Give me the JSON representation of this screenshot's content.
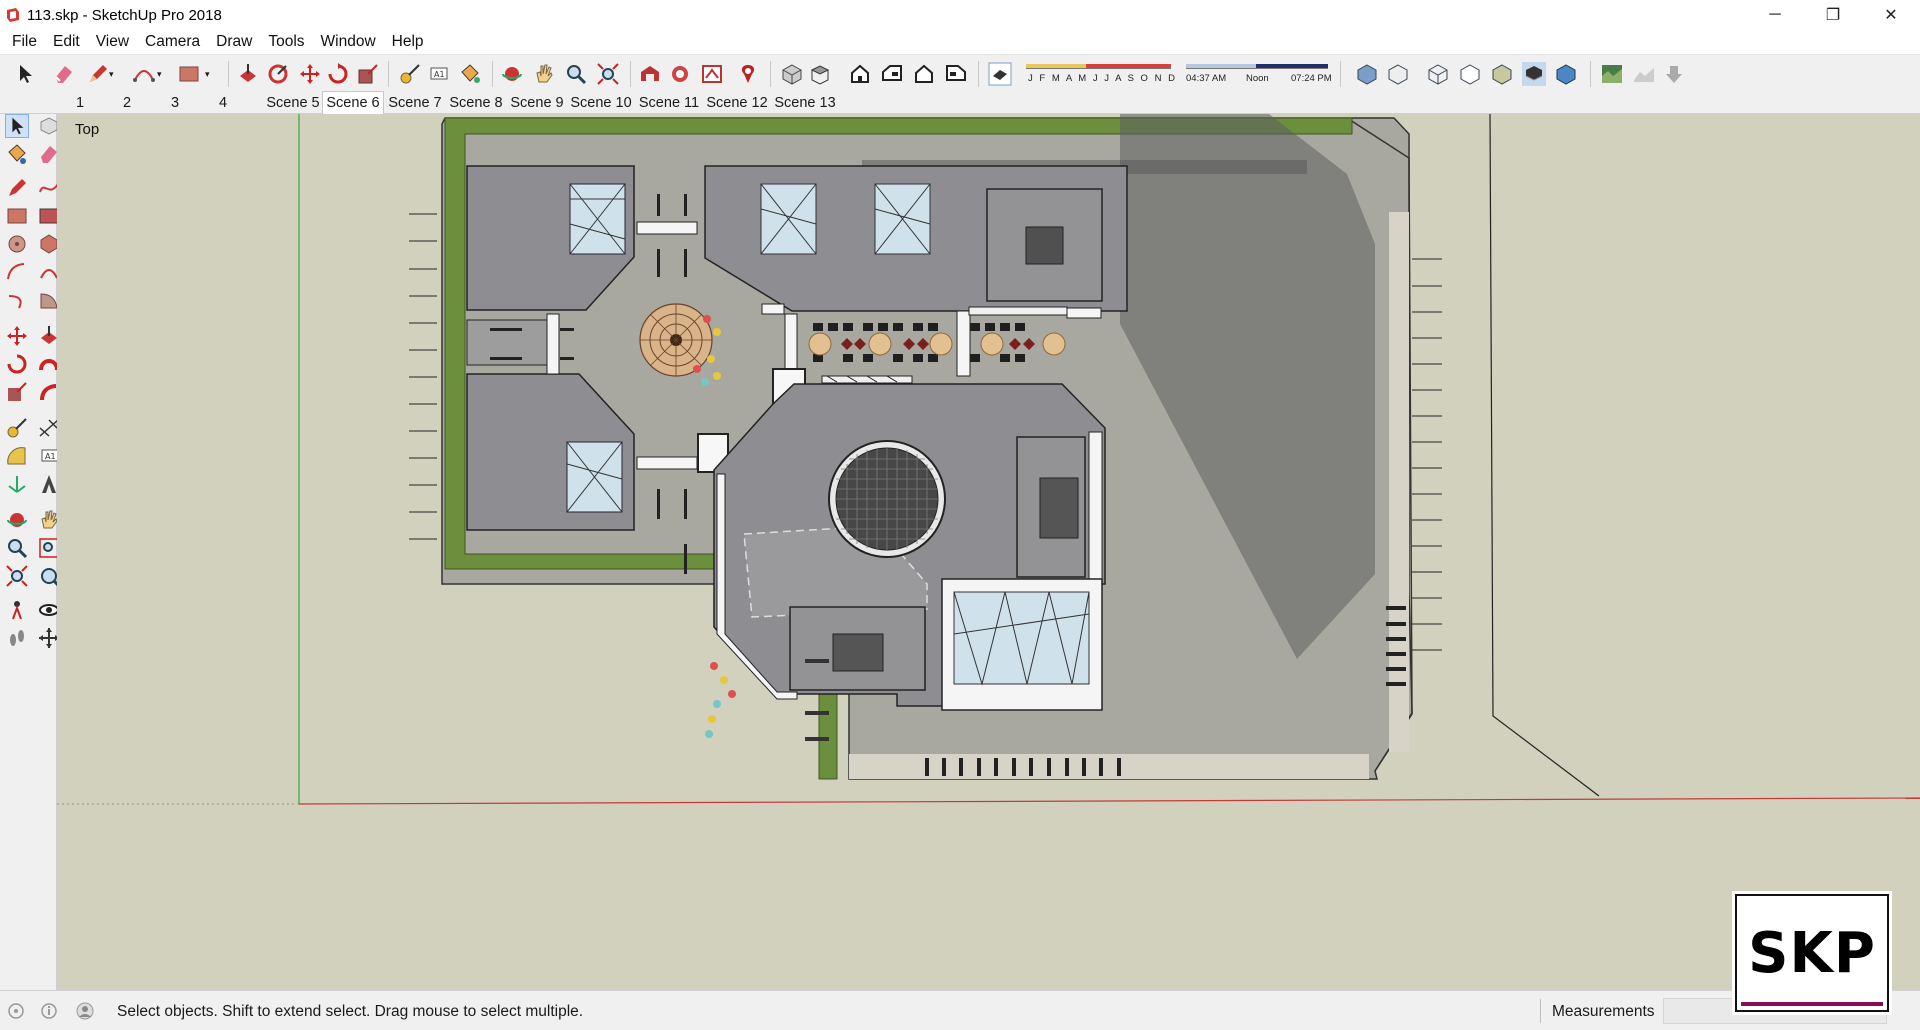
{
  "window": {
    "title": "113.skp - SketchUp Pro 2018",
    "minimize": "─",
    "restore": "❐",
    "close": "✕"
  },
  "menu": [
    "File",
    "Edit",
    "View",
    "Camera",
    "Draw",
    "Tools",
    "Window",
    "Help"
  ],
  "toolbar": {
    "months": "J F M A M J J A S O N D",
    "time_start": "04:37 AM",
    "time_mid": "Noon",
    "time_end": "07:24 PM"
  },
  "scenes": [
    "1",
    "2",
    "3",
    "4",
    "Scene 5",
    "Scene 6",
    "Scene 7",
    "Scene 8",
    "Scene 9",
    "Scene 10",
    "Scene 11",
    "Scene 12",
    "Scene 13"
  ],
  "active_scene": "Scene 6",
  "viewport": {
    "view_name": "Top"
  },
  "status": {
    "hint": "Select objects. Shift to extend select. Drag mouse to select multiple.",
    "measurements_label": "Measurements"
  },
  "logo": {
    "text": "SKP"
  },
  "colors": {
    "viewport_bg": "#d1d1bd",
    "grass": "#6c8f3e",
    "paving": "#a3a39d",
    "roof": "#8f8f93",
    "axis_green": "#3aa43a",
    "axis_red": "#c23b3b"
  }
}
